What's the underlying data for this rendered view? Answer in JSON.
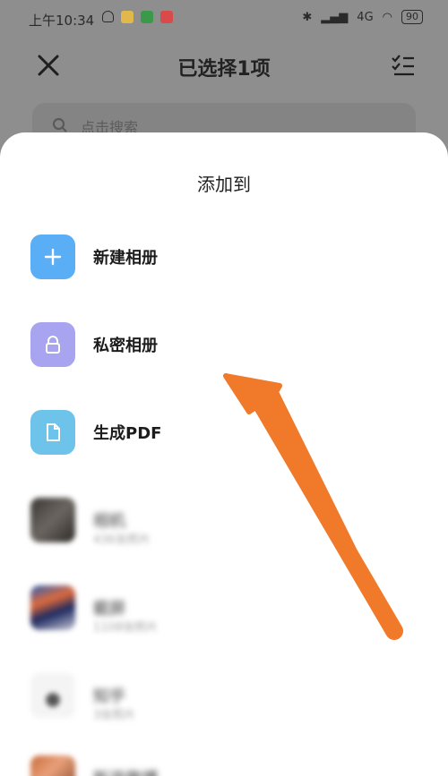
{
  "status_bar": {
    "time": "上午10:34",
    "network": "4G",
    "battery": "90"
  },
  "header": {
    "title": "已选择1项"
  },
  "search": {
    "placeholder": "点击搜索"
  },
  "sheet": {
    "title": "添加到",
    "actions": [
      {
        "label": "新建相册",
        "icon": "plus-icon",
        "color": "#5aaef5"
      },
      {
        "label": "私密相册",
        "icon": "lock-icon",
        "color": "#a8a4f0"
      },
      {
        "label": "生成PDF",
        "icon": "document-icon",
        "color": "#6ec3ea"
      }
    ],
    "albums": [
      {
        "name": "相机",
        "count": "436张照片"
      },
      {
        "name": "截屏",
        "count": "1108张照片"
      },
      {
        "name": "知乎",
        "count": "3张照片"
      },
      {
        "name": "新浪微博",
        "count": ""
      }
    ]
  },
  "annotation": {
    "arrow_color": "#f07a2a"
  }
}
